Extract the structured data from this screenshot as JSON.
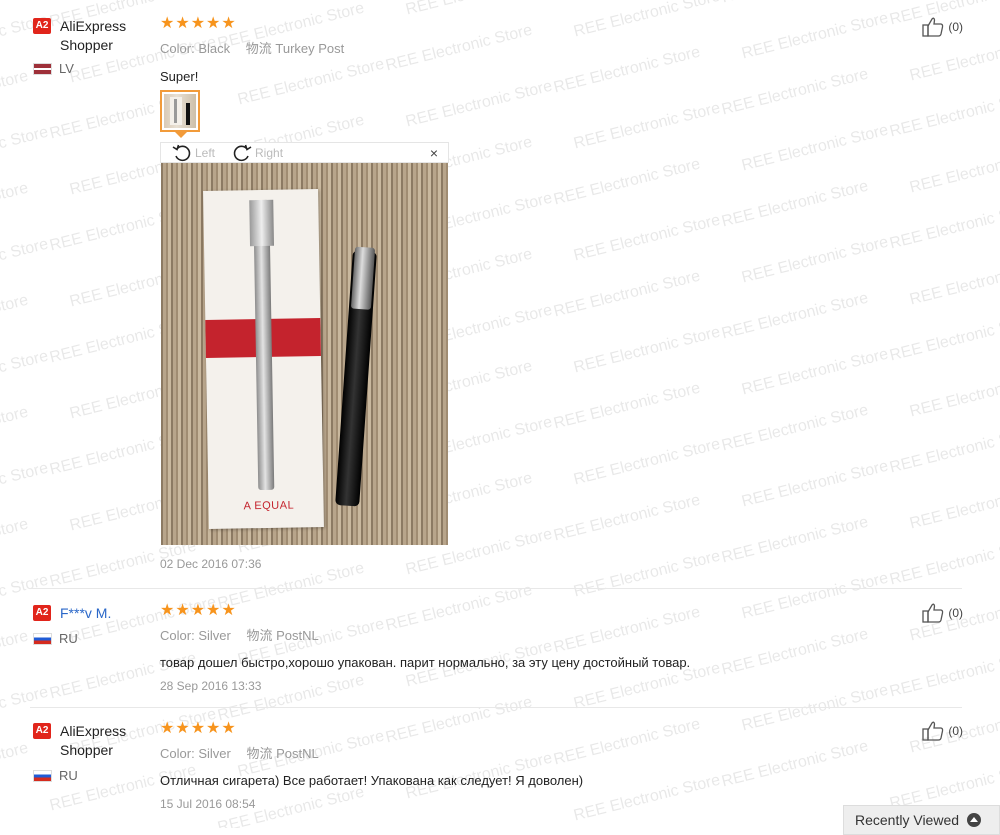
{
  "watermark_text": "REE Electronic Store",
  "photo_viewer": {
    "rotate_left_label": "Left",
    "rotate_right_label": "Right",
    "close_glyph": "×",
    "photo_box_text": "A EQUAL"
  },
  "reviews": [
    {
      "level": "A2",
      "user_name": "AliExpress Shopper",
      "country_code": "LV",
      "stars": "★★★★★",
      "color_key": "Color:",
      "color_value": "Black",
      "shipping_key": "物流",
      "shipping_value": "Turkey Post",
      "feedback": "Super!",
      "date": "02 Dec 2016 07:36",
      "helpful": "(0)"
    },
    {
      "level": "A2",
      "user_name": "F***v M.",
      "country_code": "RU",
      "stars": "★★★★★",
      "color_key": "Color:",
      "color_value": "Silver",
      "shipping_key": "物流",
      "shipping_value": "PostNL",
      "feedback": "товар дошел быстро,хорошо упакован. парит нормально, за эту цену достойный товар.",
      "date": "28 Sep 2016 13:33",
      "helpful": "(0)"
    },
    {
      "level": "A2",
      "user_name": "AliExpress Shopper",
      "country_code": "RU",
      "stars": "★★★★★",
      "color_key": "Color:",
      "color_value": "Silver",
      "shipping_key": "物流",
      "shipping_value": "PostNL",
      "feedback": "Отличная сигарета) Все работает! Упакована как следует! Я доволен)",
      "date": "15 Jul 2016 08:54",
      "helpful": "(0)"
    }
  ],
  "recently_viewed_label": "Recently Viewed",
  "colors": {
    "star": "#f7941d",
    "badge": "#e1251b",
    "link": "#2a67c8",
    "thumb_border": "#f29b3a"
  }
}
